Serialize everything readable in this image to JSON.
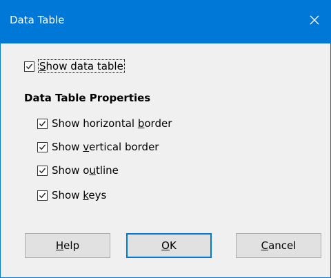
{
  "window": {
    "title": "Data Table",
    "close_icon": "close-icon"
  },
  "show_data_table": {
    "label_pre": "",
    "label_ul": "S",
    "label_post": "how data table",
    "checked": true
  },
  "section": {
    "title": "Data Table Properties"
  },
  "options": {
    "horizontal": {
      "pre": "Show horizontal ",
      "ul": "b",
      "post": "order",
      "checked": true
    },
    "vertical": {
      "pre": "Show ",
      "ul": "v",
      "post": "ertical border",
      "checked": true
    },
    "outline": {
      "pre": "Show o",
      "ul": "u",
      "post": "tline",
      "checked": true
    },
    "keys": {
      "pre": "Show ",
      "ul": "k",
      "post": "eys",
      "checked": true
    }
  },
  "buttons": {
    "help": {
      "ul": "H",
      "post": "elp"
    },
    "ok": {
      "ul": "O",
      "post": "K"
    },
    "cancel": {
      "ul": "C",
      "post": "ancel"
    }
  },
  "colors": {
    "accent": "#0078d7",
    "background": "#f0f0f0"
  }
}
